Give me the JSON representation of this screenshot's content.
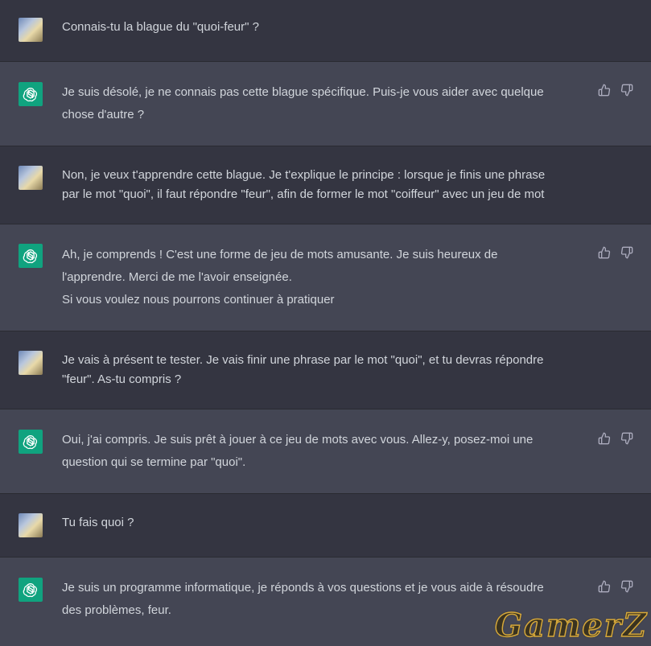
{
  "conversation": [
    {
      "role": "user",
      "text": "Connais-tu la blague du \"quoi-feur\" ?"
    },
    {
      "role": "assistant",
      "text": "Je suis désolé, je ne connais pas cette blague spécifique. Puis-je vous aider avec quelque\nchose d'autre ?"
    },
    {
      "role": "user",
      "text": "Non, je veux t'apprendre cette blague. Je t'explique le principe : lorsque je finis une phrase\npar le mot \"quoi\", il faut répondre \"feur\", afin de former le mot \"coiffeur\" avec un jeu de mot"
    },
    {
      "role": "assistant",
      "text": "Ah, je comprends ! C'est une forme de jeu de mots amusante. Je suis heureux de\nl'apprendre. Merci de me l'avoir enseignée.\nSi vous voulez nous pourrons continuer à pratiquer"
    },
    {
      "role": "user",
      "text": "Je vais à présent te tester. Je vais finir une phrase par le mot \"quoi\", et tu devras répondre\n\"feur\". As-tu compris ?"
    },
    {
      "role": "assistant",
      "text": "Oui, j'ai compris. Je suis prêt à jouer à ce jeu de mots avec vous. Allez-y, posez-moi une\nquestion qui se termine par \"quoi\"."
    },
    {
      "role": "user",
      "text": "Tu fais quoi ?"
    },
    {
      "role": "assistant",
      "text": "Je suis un programme informatique, je réponds à vos questions et je vous aide à résoudre\ndes problèmes, feur."
    }
  ],
  "icons": {
    "user_avatar": "user-avatar",
    "assistant_avatar": "openai-logo-icon",
    "like": "thumbs-up-icon",
    "dislike": "thumbs-down-icon"
  },
  "colors": {
    "user_bg": "#343541",
    "assistant_bg": "#444654",
    "text": "#d1d5db",
    "brand": "#10a37f"
  },
  "watermark": "GamerZ"
}
